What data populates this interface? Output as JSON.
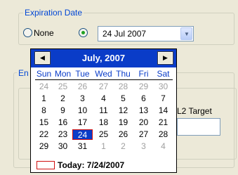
{
  "expiration_group": {
    "legend": "Expiration Date",
    "none_label": "None",
    "date_value": "24  Jul  2007",
    "dropdown_icon": "chevron-down-icon"
  },
  "background_group": {
    "legend_fragment": "En",
    "label_fragment": "L2 Target"
  },
  "calendar": {
    "title": "July, 2007",
    "prev_icon": "arrow-left-icon",
    "next_icon": "arrow-right-icon",
    "weekdays": [
      "Sun",
      "Mon",
      "Tue",
      "Wed",
      "Thu",
      "Fri",
      "Sat"
    ],
    "weeks": [
      [
        {
          "d": "24",
          "o": true
        },
        {
          "d": "25",
          "o": true
        },
        {
          "d": "26",
          "o": true
        },
        {
          "d": "27",
          "o": true
        },
        {
          "d": "28",
          "o": true
        },
        {
          "d": "29",
          "o": true
        },
        {
          "d": "30",
          "o": true
        }
      ],
      [
        {
          "d": "1"
        },
        {
          "d": "2"
        },
        {
          "d": "3"
        },
        {
          "d": "4"
        },
        {
          "d": "5"
        },
        {
          "d": "6"
        },
        {
          "d": "7"
        }
      ],
      [
        {
          "d": "8"
        },
        {
          "d": "9"
        },
        {
          "d": "10"
        },
        {
          "d": "11"
        },
        {
          "d": "12"
        },
        {
          "d": "13"
        },
        {
          "d": "14"
        }
      ],
      [
        {
          "d": "15"
        },
        {
          "d": "16"
        },
        {
          "d": "17"
        },
        {
          "d": "18"
        },
        {
          "d": "19"
        },
        {
          "d": "20"
        },
        {
          "d": "21"
        }
      ],
      [
        {
          "d": "22"
        },
        {
          "d": "23"
        },
        {
          "d": "24",
          "s": true
        },
        {
          "d": "25"
        },
        {
          "d": "26"
        },
        {
          "d": "27"
        },
        {
          "d": "28"
        }
      ],
      [
        {
          "d": "29"
        },
        {
          "d": "30"
        },
        {
          "d": "31"
        },
        {
          "d": "1",
          "o": true
        },
        {
          "d": "2",
          "o": true
        },
        {
          "d": "3",
          "o": true
        },
        {
          "d": "4",
          "o": true
        }
      ]
    ],
    "today_label": "Today: 7/24/2007",
    "colors": {
      "header_bg": "#0a3cc8",
      "weekday_text": "#0a3cc8",
      "selected_bg": "#0a3cc8",
      "selected_border": "#d01010",
      "today_marker": "#d01010",
      "other_month_text": "#a0a0a0"
    }
  }
}
